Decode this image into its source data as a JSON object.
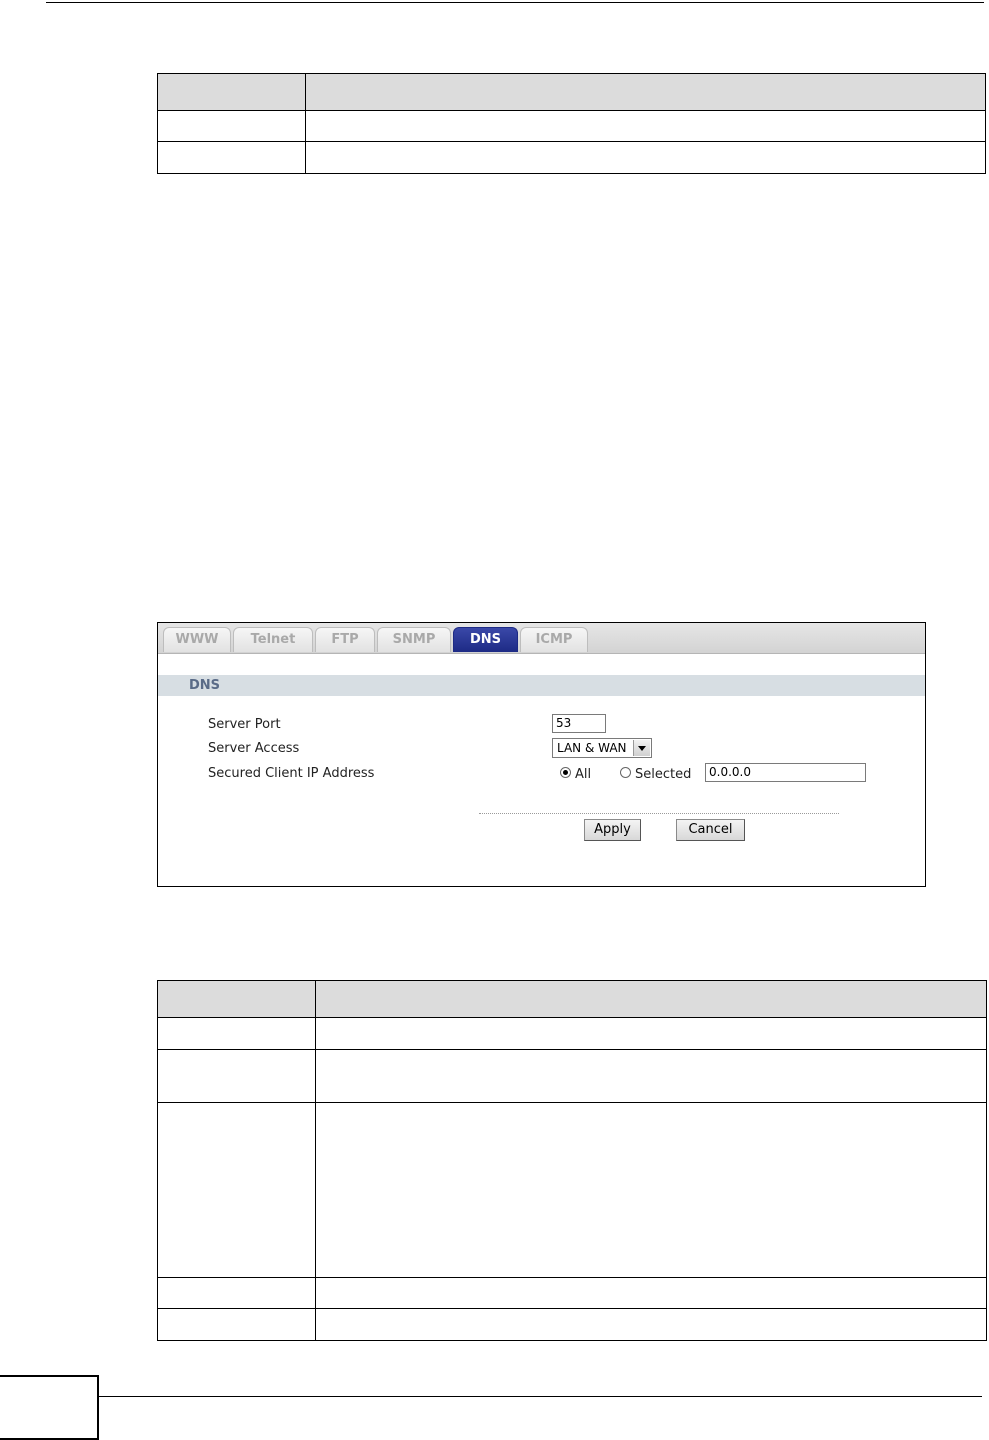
{
  "dns_panel": {
    "tabs": [
      {
        "label": "WWW",
        "active": false
      },
      {
        "label": "Telnet",
        "active": false
      },
      {
        "label": "FTP",
        "active": false
      },
      {
        "label": "SNMP",
        "active": false
      },
      {
        "label": "DNS",
        "active": true
      },
      {
        "label": "ICMP",
        "active": false
      }
    ],
    "section_title": "DNS",
    "fields": {
      "server_port_label": "Server Port",
      "server_port_value": "53",
      "server_access_label": "Server Access",
      "server_access_value": "LAN & WAN",
      "secured_client_label": "Secured Client IP Address",
      "radio_all_label": "All",
      "radio_selected_label": "Selected",
      "selected_ip_value": "0.0.0.0",
      "selected_option": "All"
    },
    "buttons": {
      "apply": "Apply",
      "cancel": "Cancel"
    }
  },
  "colors": {
    "active_tab": "#1d2a85",
    "section_band": "#d7dee3",
    "section_title": "#5a6b87",
    "table_header": "#dcdcdc"
  }
}
